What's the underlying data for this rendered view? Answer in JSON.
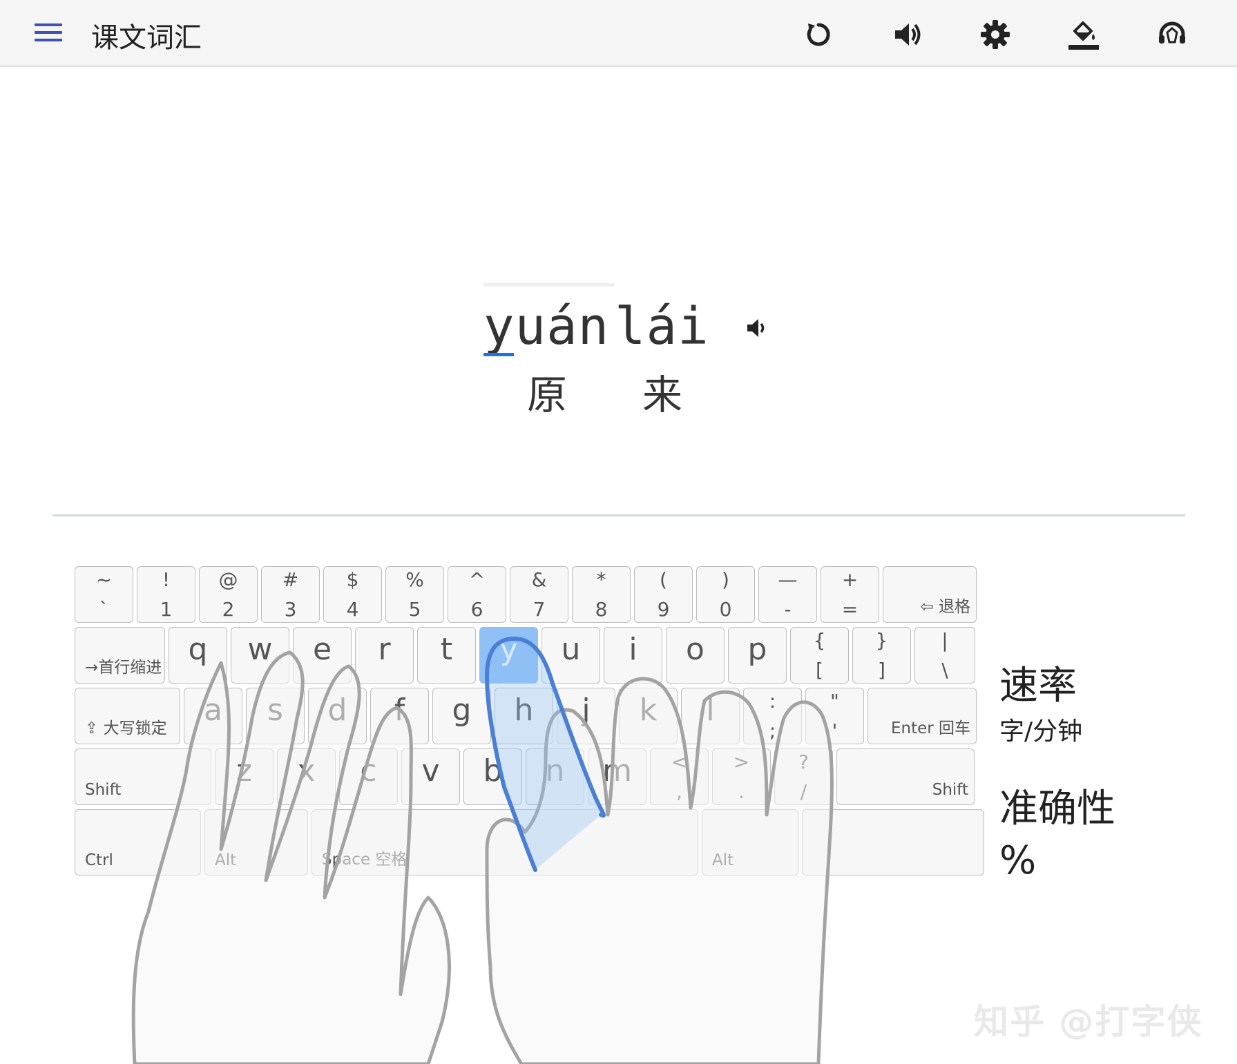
{
  "app": {
    "title": "课文词汇",
    "icons": {
      "menu": "menu-icon",
      "refresh": "refresh-icon",
      "sound": "volume-icon",
      "settings": "gear-icon",
      "theme": "paint-bucket-icon",
      "support": "headset-icon"
    }
  },
  "word": {
    "syllables": [
      {
        "pinyin": "yuán",
        "hanzi": "原"
      },
      {
        "pinyin": "lái",
        "hanzi": "来"
      }
    ],
    "current_letter": "y"
  },
  "keyboard": {
    "highlight_key": "y",
    "rows": [
      [
        {
          "top": "~",
          "bottom": "`"
        },
        {
          "top": "!",
          "bottom": "1"
        },
        {
          "top": "@",
          "bottom": "2"
        },
        {
          "top": "#",
          "bottom": "3"
        },
        {
          "top": "$",
          "bottom": "4"
        },
        {
          "top": "%",
          "bottom": "5"
        },
        {
          "top": "^",
          "bottom": "6"
        },
        {
          "top": "&",
          "bottom": "7"
        },
        {
          "top": "*",
          "bottom": "8"
        },
        {
          "top": "(",
          "bottom": "9"
        },
        {
          "top": ")",
          "bottom": "0"
        },
        {
          "top": "—",
          "bottom": "-"
        },
        {
          "top": "+",
          "bottom": "="
        },
        {
          "label": "⇦ 退格"
        }
      ],
      [
        {
          "label": "→首行缩进"
        },
        {
          "main": "q"
        },
        {
          "main": "w"
        },
        {
          "main": "e"
        },
        {
          "main": "r"
        },
        {
          "main": "t"
        },
        {
          "main": "y"
        },
        {
          "main": "u"
        },
        {
          "main": "i"
        },
        {
          "main": "o"
        },
        {
          "main": "p"
        },
        {
          "top": "{",
          "bottom": "["
        },
        {
          "top": "}",
          "bottom": "]"
        },
        {
          "top": "|",
          "bottom": "\\"
        }
      ],
      [
        {
          "label": "⇪ 大写锁定"
        },
        {
          "main": "a"
        },
        {
          "main": "s"
        },
        {
          "main": "d"
        },
        {
          "main": "f"
        },
        {
          "main": "g"
        },
        {
          "main": "h"
        },
        {
          "main": "j"
        },
        {
          "main": "k"
        },
        {
          "main": "l"
        },
        {
          "top": ":",
          "bottom": ";"
        },
        {
          "top": "\"",
          "bottom": "'"
        },
        {
          "label": "Enter 回车"
        }
      ],
      [
        {
          "label": "Shift"
        },
        {
          "main": "z"
        },
        {
          "main": "x"
        },
        {
          "main": "c"
        },
        {
          "main": "v"
        },
        {
          "main": "b"
        },
        {
          "main": "n"
        },
        {
          "main": "m"
        },
        {
          "top": "<",
          "bottom": ","
        },
        {
          "top": ">",
          "bottom": "."
        },
        {
          "top": "?",
          "bottom": "/"
        },
        {
          "label": "Shift"
        }
      ],
      [
        {
          "label": "Ctrl"
        },
        {
          "label": "Alt"
        },
        {
          "label": "Space 空格"
        },
        {
          "label": "Alt"
        },
        {
          "label": ""
        }
      ]
    ]
  },
  "stats": {
    "speed_label": "速率",
    "speed_unit": "字/分钟",
    "accuracy_label": "准确性",
    "accuracy_unit": "%"
  },
  "watermark": "知乎 @打字侠",
  "colors": {
    "accent": "#3f51b5",
    "highlight": "#90c0f5",
    "cursor": "#1a73e8",
    "finger": "#4a7fd4"
  }
}
